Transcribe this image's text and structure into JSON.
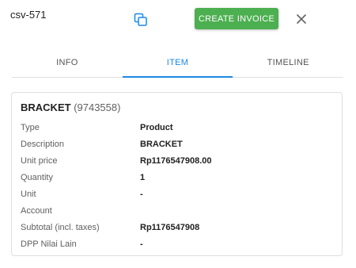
{
  "header": {
    "doc_id": "csv-571",
    "copy_icon": "copy-icon",
    "create_invoice_label": "CREATE INVOICE",
    "close_icon": "close-icon"
  },
  "tabs": [
    {
      "label": "INFO",
      "active": false
    },
    {
      "label": "ITEM",
      "active": true
    },
    {
      "label": "TIMELINE",
      "active": false
    }
  ],
  "item": {
    "name": "BRACKET",
    "code": "(9743558)",
    "rows": [
      {
        "label": "Type",
        "value": "Product"
      },
      {
        "label": "Description",
        "value": "BRACKET"
      },
      {
        "label": "Unit price",
        "value": "Rp1176547908.00"
      },
      {
        "label": "Quantity",
        "value": "1"
      },
      {
        "label": "Unit",
        "value": "-"
      },
      {
        "label": "Account",
        "value": ""
      },
      {
        "label": "Subtotal (incl. taxes)",
        "value": "Rp1176547908"
      },
      {
        "label": "DPP Nilai Lain",
        "value": "-"
      }
    ]
  },
  "colors": {
    "accent": "#1e88e5",
    "create_button": "#4caf50"
  }
}
